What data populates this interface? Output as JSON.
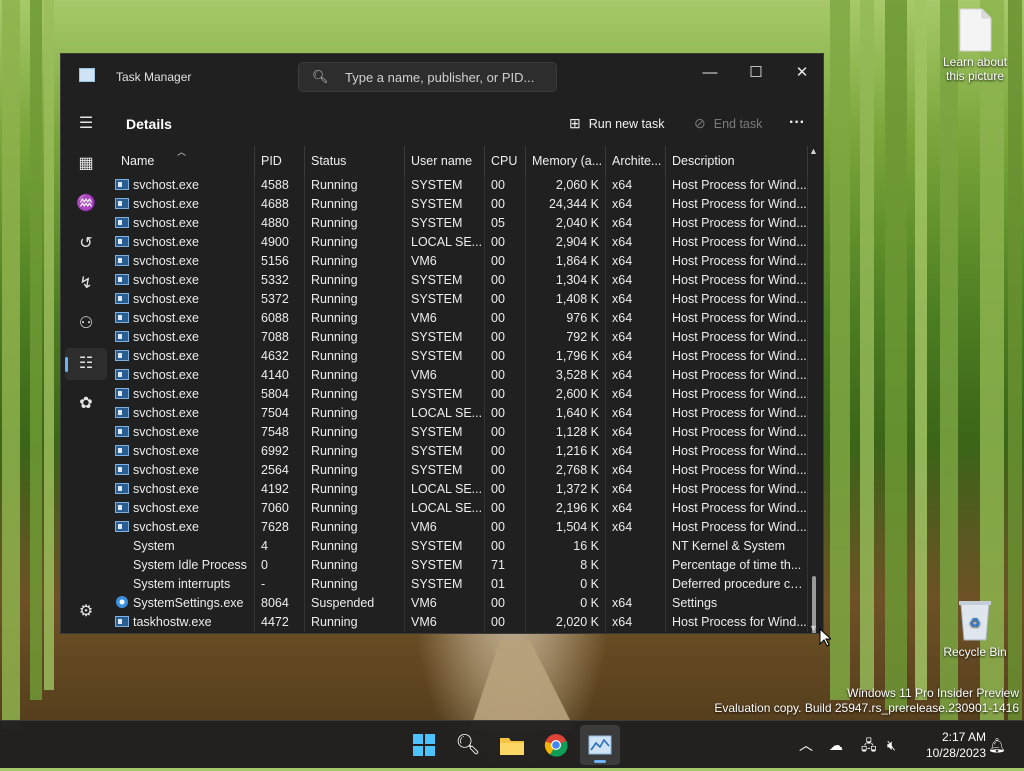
{
  "window": {
    "title": "Task Manager",
    "search_placeholder": "Type a name, publisher, or PID...",
    "page_title": "Details",
    "run_new_task": "Run new task",
    "end_task": "End task"
  },
  "columns": [
    "Name",
    "PID",
    "Status",
    "User name",
    "CPU",
    "Memory (a...",
    "Archite...",
    "Description"
  ],
  "processes": [
    {
      "name": "svchost.exe",
      "pid": "4588",
      "status": "Running",
      "user": "SYSTEM",
      "cpu": "00",
      "mem": "2,060 K",
      "arch": "x64",
      "desc": "Host Process for Wind...",
      "icon": "app-icon"
    },
    {
      "name": "svchost.exe",
      "pid": "4688",
      "status": "Running",
      "user": "SYSTEM",
      "cpu": "00",
      "mem": "24,344 K",
      "arch": "x64",
      "desc": "Host Process for Wind...",
      "icon": "app-icon"
    },
    {
      "name": "svchost.exe",
      "pid": "4880",
      "status": "Running",
      "user": "SYSTEM",
      "cpu": "05",
      "mem": "2,040 K",
      "arch": "x64",
      "desc": "Host Process for Wind...",
      "icon": "app-icon"
    },
    {
      "name": "svchost.exe",
      "pid": "4900",
      "status": "Running",
      "user": "LOCAL SE...",
      "cpu": "00",
      "mem": "2,904 K",
      "arch": "x64",
      "desc": "Host Process for Wind...",
      "icon": "app-icon"
    },
    {
      "name": "svchost.exe",
      "pid": "5156",
      "status": "Running",
      "user": "VM6",
      "cpu": "00",
      "mem": "1,864 K",
      "arch": "x64",
      "desc": "Host Process for Wind...",
      "icon": "app-icon"
    },
    {
      "name": "svchost.exe",
      "pid": "5332",
      "status": "Running",
      "user": "SYSTEM",
      "cpu": "00",
      "mem": "1,304 K",
      "arch": "x64",
      "desc": "Host Process for Wind...",
      "icon": "app-icon"
    },
    {
      "name": "svchost.exe",
      "pid": "5372",
      "status": "Running",
      "user": "SYSTEM",
      "cpu": "00",
      "mem": "1,408 K",
      "arch": "x64",
      "desc": "Host Process for Wind...",
      "icon": "app-icon"
    },
    {
      "name": "svchost.exe",
      "pid": "6088",
      "status": "Running",
      "user": "VM6",
      "cpu": "00",
      "mem": "976 K",
      "arch": "x64",
      "desc": "Host Process for Wind...",
      "icon": "app-icon"
    },
    {
      "name": "svchost.exe",
      "pid": "7088",
      "status": "Running",
      "user": "SYSTEM",
      "cpu": "00",
      "mem": "792 K",
      "arch": "x64",
      "desc": "Host Process for Wind...",
      "icon": "app-icon"
    },
    {
      "name": "svchost.exe",
      "pid": "4632",
      "status": "Running",
      "user": "SYSTEM",
      "cpu": "00",
      "mem": "1,796 K",
      "arch": "x64",
      "desc": "Host Process for Wind...",
      "icon": "app-icon"
    },
    {
      "name": "svchost.exe",
      "pid": "4140",
      "status": "Running",
      "user": "VM6",
      "cpu": "00",
      "mem": "3,528 K",
      "arch": "x64",
      "desc": "Host Process for Wind...",
      "icon": "app-icon"
    },
    {
      "name": "svchost.exe",
      "pid": "5804",
      "status": "Running",
      "user": "SYSTEM",
      "cpu": "00",
      "mem": "2,600 K",
      "arch": "x64",
      "desc": "Host Process for Wind...",
      "icon": "app-icon"
    },
    {
      "name": "svchost.exe",
      "pid": "7504",
      "status": "Running",
      "user": "LOCAL SE...",
      "cpu": "00",
      "mem": "1,640 K",
      "arch": "x64",
      "desc": "Host Process for Wind...",
      "icon": "app-icon"
    },
    {
      "name": "svchost.exe",
      "pid": "7548",
      "status": "Running",
      "user": "SYSTEM",
      "cpu": "00",
      "mem": "1,128 K",
      "arch": "x64",
      "desc": "Host Process for Wind...",
      "icon": "app-icon"
    },
    {
      "name": "svchost.exe",
      "pid": "6992",
      "status": "Running",
      "user": "SYSTEM",
      "cpu": "00",
      "mem": "1,216 K",
      "arch": "x64",
      "desc": "Host Process for Wind...",
      "icon": "app-icon"
    },
    {
      "name": "svchost.exe",
      "pid": "2564",
      "status": "Running",
      "user": "SYSTEM",
      "cpu": "00",
      "mem": "2,768 K",
      "arch": "x64",
      "desc": "Host Process for Wind...",
      "icon": "app-icon"
    },
    {
      "name": "svchost.exe",
      "pid": "4192",
      "status": "Running",
      "user": "LOCAL SE...",
      "cpu": "00",
      "mem": "1,372 K",
      "arch": "x64",
      "desc": "Host Process for Wind...",
      "icon": "app-icon"
    },
    {
      "name": "svchost.exe",
      "pid": "7060",
      "status": "Running",
      "user": "LOCAL SE...",
      "cpu": "00",
      "mem": "2,196 K",
      "arch": "x64",
      "desc": "Host Process for Wind...",
      "icon": "app-icon"
    },
    {
      "name": "svchost.exe",
      "pid": "7628",
      "status": "Running",
      "user": "VM6",
      "cpu": "00",
      "mem": "1,504 K",
      "arch": "x64",
      "desc": "Host Process for Wind...",
      "icon": "app-icon"
    },
    {
      "name": "System",
      "pid": "4",
      "status": "Running",
      "user": "SYSTEM",
      "cpu": "00",
      "mem": "16 K",
      "arch": "",
      "desc": "NT Kernel & System",
      "icon": "none"
    },
    {
      "name": "System Idle Process",
      "pid": "0",
      "status": "Running",
      "user": "SYSTEM",
      "cpu": "71",
      "mem": "8 K",
      "arch": "",
      "desc": "Percentage of time th...",
      "icon": "none"
    },
    {
      "name": "System interrupts",
      "pid": "-",
      "status": "Running",
      "user": "SYSTEM",
      "cpu": "01",
      "mem": "0 K",
      "arch": "",
      "desc": "Deferred procedure ca...",
      "icon": "none"
    },
    {
      "name": "SystemSettings.exe",
      "pid": "8064",
      "status": "Suspended",
      "user": "VM6",
      "cpu": "00",
      "mem": "0 K",
      "arch": "x64",
      "desc": "Settings",
      "icon": "gear-icon"
    },
    {
      "name": "taskhostw.exe",
      "pid": "4472",
      "status": "Running",
      "user": "VM6",
      "cpu": "00",
      "mem": "2,020 K",
      "arch": "x64",
      "desc": "Host Process for Wind...",
      "icon": "app-icon"
    }
  ],
  "desktop": {
    "learn_label_1": "Learn about",
    "learn_label_2": "this picture",
    "recycle_bin": "Recycle Bin",
    "watermark_1": "Windows 11 Pro Insider Preview",
    "watermark_2": "Evaluation copy. Build 25947.rs_prerelease.230901-1416"
  },
  "taskbar": {
    "time": "2:17 AM",
    "date": "10/28/2023"
  },
  "colors": {
    "accent": "#6ab4f5",
    "window_bg": "#202020"
  }
}
